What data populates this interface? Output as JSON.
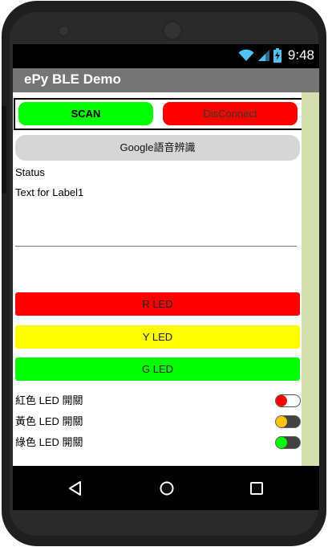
{
  "status_bar": {
    "time": "9:48",
    "icons": [
      "wifi-icon",
      "signal-icon",
      "battery-icon"
    ]
  },
  "app_bar": {
    "title": "ePy BLE Demo"
  },
  "buttons": {
    "scan": "SCAN",
    "disconnect": "DisConnect",
    "google_speech": "Google語音辨識"
  },
  "labels": {
    "status": "Status",
    "label1": "Text for Label1"
  },
  "led_buttons": [
    {
      "label": "R LED",
      "color": "#ff0000"
    },
    {
      "label": "Y LED",
      "color": "#ffff00"
    },
    {
      "label": "G LED",
      "color": "#00ff00"
    }
  ],
  "switches": [
    {
      "label": "紅色 LED 開關",
      "thumb_color": "#ff0000",
      "track_color": "#ffffff"
    },
    {
      "label": "黃色 LED 開關",
      "thumb_color": "#ffc107",
      "track_color": "#424242"
    },
    {
      "label": "綠色 LED 開關",
      "thumb_color": "#00ff00",
      "track_color": "#424242"
    }
  ],
  "nav_bar": {
    "icons": [
      "back-icon",
      "home-icon",
      "recent-apps-icon"
    ]
  }
}
